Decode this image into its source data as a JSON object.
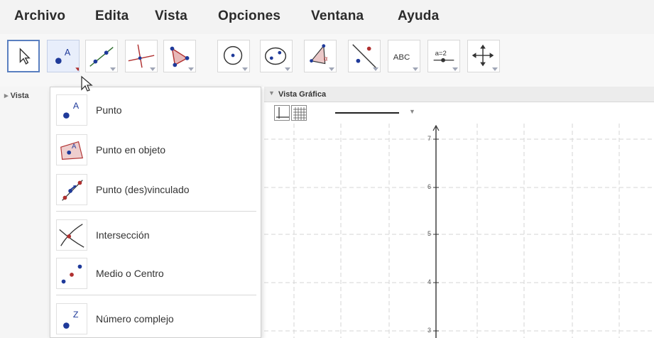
{
  "menubar": {
    "items": [
      "Archivo",
      "Edita",
      "Vista",
      "Opciones",
      "Ventana",
      "Ayuda"
    ]
  },
  "toolbar": {
    "tools": [
      {
        "name": "move-tool",
        "icon": "cursor-arrow-icon",
        "selected": true
      },
      {
        "name": "point-tool",
        "icon": "point-icon",
        "active": true,
        "label": "A"
      },
      {
        "name": "line-tool",
        "icon": "line-icon"
      },
      {
        "name": "perpendicular-tool",
        "icon": "perpendicular-icon"
      },
      {
        "name": "polygon-tool",
        "icon": "polygon-icon"
      },
      {
        "name": "circle-tool",
        "icon": "circle-icon"
      },
      {
        "name": "conic-tool",
        "icon": "ellipse-icon"
      },
      {
        "name": "angle-tool",
        "icon": "angle-icon",
        "label": "α"
      },
      {
        "name": "reflect-tool",
        "icon": "reflect-icon"
      },
      {
        "name": "text-tool",
        "icon": "text-icon",
        "label": "ABC"
      },
      {
        "name": "slider-tool",
        "icon": "slider-icon",
        "label": "a=2"
      },
      {
        "name": "move-view-tool",
        "icon": "move-arrows-icon"
      }
    ]
  },
  "left_panel": {
    "header": "Vista"
  },
  "graphics": {
    "title": "Vista Gráfica",
    "y_labels": [
      "7",
      "6",
      "5",
      "4",
      "3"
    ]
  },
  "dropdown": {
    "items": [
      {
        "label": "Punto",
        "icon": "point-icon"
      },
      {
        "label": "Punto en objeto",
        "icon": "point-on-object-icon"
      },
      {
        "label": "Punto (des)vinculado",
        "icon": "attach-detach-point-icon"
      },
      {
        "label": "Intersección",
        "icon": "intersection-icon"
      },
      {
        "label": "Medio o Centro",
        "icon": "midpoint-icon"
      },
      {
        "label": "Número complejo",
        "icon": "complex-number-icon"
      }
    ],
    "point_label": "A",
    "complex_label": "Z"
  },
  "colors": {
    "point_blue": "#1f3a9a",
    "accent_red": "#b03030",
    "grid": "#d6d6d6",
    "selected_border": "#5a7fc0"
  }
}
